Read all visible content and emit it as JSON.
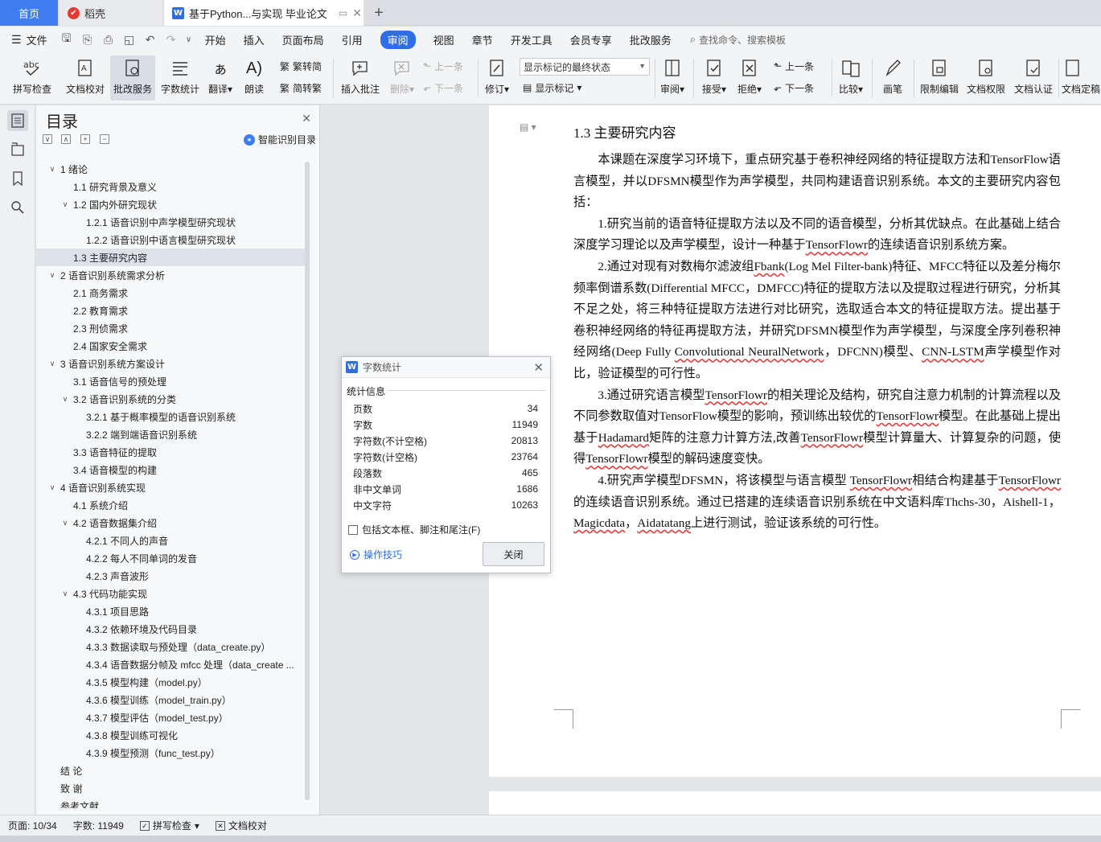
{
  "tabs": {
    "home": "首页",
    "daoke": "稻壳",
    "doc": "基于Python...与实现 毕业论文"
  },
  "menubar": {
    "file": "文件",
    "items": [
      "开始",
      "插入",
      "页面布局",
      "引用",
      "审阅",
      "视图",
      "章节",
      "开发工具",
      "会员专享",
      "批改服务"
    ],
    "active": "审阅",
    "search": "查找命令、搜索模板"
  },
  "ribbon": {
    "spell": "拼写检查",
    "proof": "文档校对",
    "correct": "批改服务",
    "count": "字数统计",
    "translate": "翻译",
    "read": "朗读",
    "t2s": "繁转简",
    "s2t": "简转繁",
    "insert_comment": "插入批注",
    "delete": "删除",
    "prev": "上一条",
    "next": "下一条",
    "revise": "修订",
    "review_state": "显示标记的最终状态",
    "show_marks": "显示标记",
    "review": "审阅",
    "accept": "接受",
    "reject": "拒绝",
    "prev2": "上一条",
    "next2": "下一条",
    "compare": "比较",
    "pen": "画笔",
    "restrict": "限制编辑",
    "perm": "文档权限",
    "cert": "文档认证",
    "final": "文档定稿"
  },
  "toc": {
    "title": "目录",
    "smart": "智能识别目录",
    "items": [
      {
        "text": "1  绪论",
        "level": 1,
        "tw": "∨"
      },
      {
        "text": "1.1  研究背景及意义",
        "level": 2,
        "tw": ""
      },
      {
        "text": "1.2  国内外研究现状",
        "level": 2,
        "tw": "∨"
      },
      {
        "text": "1.2.1  语音识别中声学模型研究现状",
        "level": 3,
        "tw": ""
      },
      {
        "text": "1.2.2  语音识别中语言模型研究现状",
        "level": 3,
        "tw": ""
      },
      {
        "text": "1.3  主要研究内容",
        "level": 2,
        "tw": "",
        "selected": true
      },
      {
        "text": "2  语音识别系统需求分析",
        "level": 1,
        "tw": "∨"
      },
      {
        "text": "2.1  商务需求",
        "level": 2,
        "tw": ""
      },
      {
        "text": "2.2  教育需求",
        "level": 2,
        "tw": ""
      },
      {
        "text": "2.3  刑侦需求",
        "level": 2,
        "tw": ""
      },
      {
        "text": "2.4  国家安全需求",
        "level": 2,
        "tw": ""
      },
      {
        "text": "3  语音识别系统方案设计",
        "level": 1,
        "tw": "∨"
      },
      {
        "text": "3.1  语音信号的预处理",
        "level": 2,
        "tw": ""
      },
      {
        "text": "3.2  语音识别系统的分类",
        "level": 2,
        "tw": "∨"
      },
      {
        "text": "3.2.1  基于概率模型的语音识别系统",
        "level": 3,
        "tw": ""
      },
      {
        "text": "3.2.2  端到端语音识别系统",
        "level": 3,
        "tw": ""
      },
      {
        "text": "3.3  语音特征的提取",
        "level": 2,
        "tw": ""
      },
      {
        "text": "3.4  语音模型的构建",
        "level": 2,
        "tw": ""
      },
      {
        "text": "4  语音识别系统实现",
        "level": 1,
        "tw": "∨"
      },
      {
        "text": "4.1  系统介绍",
        "level": 2,
        "tw": ""
      },
      {
        "text": "4.2  语音数据集介绍",
        "level": 2,
        "tw": "∨"
      },
      {
        "text": "4.2.1  不同人的声音",
        "level": 3,
        "tw": ""
      },
      {
        "text": "4.2.2  每人不同单词的发音",
        "level": 3,
        "tw": ""
      },
      {
        "text": "4.2.3  声音波形",
        "level": 3,
        "tw": ""
      },
      {
        "text": "4.3  代码功能实现",
        "level": 2,
        "tw": "∨"
      },
      {
        "text": "4.3.1  项目思路",
        "level": 3,
        "tw": ""
      },
      {
        "text": "4.3.2  依赖环境及代码目录",
        "level": 3,
        "tw": ""
      },
      {
        "text": "4.3.3  数据读取与预处理（data_create.py）",
        "level": 3,
        "tw": ""
      },
      {
        "text": "4.3.4  语音数据分帧及 mfcc 处理（data_create ...",
        "level": 3,
        "tw": ""
      },
      {
        "text": "4.3.5  模型构建（model.py）",
        "level": 3,
        "tw": ""
      },
      {
        "text": "4.3.6  模型训练（model_train.py）",
        "level": 3,
        "tw": ""
      },
      {
        "text": "4.3.7  模型评估（model_test.py）",
        "level": 3,
        "tw": ""
      },
      {
        "text": "4.3.8  模型训练可视化",
        "level": 3,
        "tw": ""
      },
      {
        "text": "4.3.9  模型预测（func_test.py）",
        "level": 3,
        "tw": ""
      },
      {
        "text": "结    论",
        "level": 0,
        "tw": ""
      },
      {
        "text": "致    谢",
        "level": 0,
        "tw": ""
      },
      {
        "text": "参考文献",
        "level": 0,
        "tw": ""
      }
    ]
  },
  "doc": {
    "heading": "1.3   主要研究内容",
    "p1": "本课题在深度学习环境下，重点研究基于卷积神经网络的特征提取方法和TensorFlow语言模型，并以DFSMN模型作为声学模型，共同构建语音识别系统。本文的主要研究内容包括：",
    "p2a": "1.研究当前的语音特征提取方法以及不同的语音模型，分析其优缺点。在此基础上结合深度学习理论以及声学模型，设计一种基于",
    "p2u": "TensorFlowr",
    "p2b": "的连续语音识别系统方案。",
    "p3a": "2.通过对现有对数梅尔滤波组",
    "p3u": "Fbank",
    "p3b": "(Log Mel Filter-bank)特征、MFCC特征以及差分梅尔频率倒谱系数(Differential MFCC，DMFCC)特征的提取方法以及提取过程进行研究，分析其不足之处，将三种特征提取方法进行对比研究，选取适合本文的特征提取方法。提出基于卷积神经网络的特征再提取方法，并研究DFSMN模型作为声学模型，与深度全序列卷积神经网络(Deep Fully ",
    "p3u2": "Convolutional NeuralNetwork",
    "p3c": "，DFCNN)模型、",
    "p3u3": "CNN-LSTM",
    "p3d": "声学模型作对比，验证模型的可行性。",
    "p4a": "3.通过研究语言模型",
    "p4u": "TensorFlowr",
    "p4b": "的相关理论及结构，研究自注意力机制的计算流程以及不同参数取值对TensorFlow模型的影响，预训练出较优的",
    "p4u2": "TensorFlowr",
    "p4c": "模型。在此基础上提出基于",
    "p4u3": "Hadamard",
    "p4d": "矩阵的注意力计算方法,改善",
    "p4u4": "TensorFlowr",
    "p4e": "模型计算量大、计算复杂的问题，使得",
    "p4u5": "TensorFlowr",
    "p4f": "模型的解码速度变快。",
    "p5a": "4.研究声学模型DFSMN，将该模型与语言模型 ",
    "p5u": "TensorFlowr",
    "p5b": "相结合构建基于",
    "p5u2": "TensorFlowr",
    "p5c": "的连续语音识别系统。通过已搭建的连续语音识别系统在中文语料库Thchs-30，Aishell-1，",
    "p5u3": "Magicdata",
    "p5d": "，",
    "p5u4": "Aidatatang",
    "p5e": "上进行测试，验证该系统的可行性。"
  },
  "dialog": {
    "title": "字数统计",
    "section": "统计信息",
    "stats": [
      {
        "label": "页数",
        "value": "34"
      },
      {
        "label": "字数",
        "value": "11949"
      },
      {
        "label": "字符数(不计空格)",
        "value": "20813"
      },
      {
        "label": "字符数(计空格)",
        "value": "23764"
      },
      {
        "label": "段落数",
        "value": "465"
      },
      {
        "label": "非中文单词",
        "value": "1686"
      },
      {
        "label": "中文字符",
        "value": "10263"
      }
    ],
    "checkbox": "包括文本框、脚注和尾注(F)",
    "tips": "操作技巧",
    "close": "关闭"
  },
  "status": {
    "page": "页面: 10/34",
    "words": "字数: 11949",
    "spell": "拼写检查",
    "proof": "文档校对"
  }
}
